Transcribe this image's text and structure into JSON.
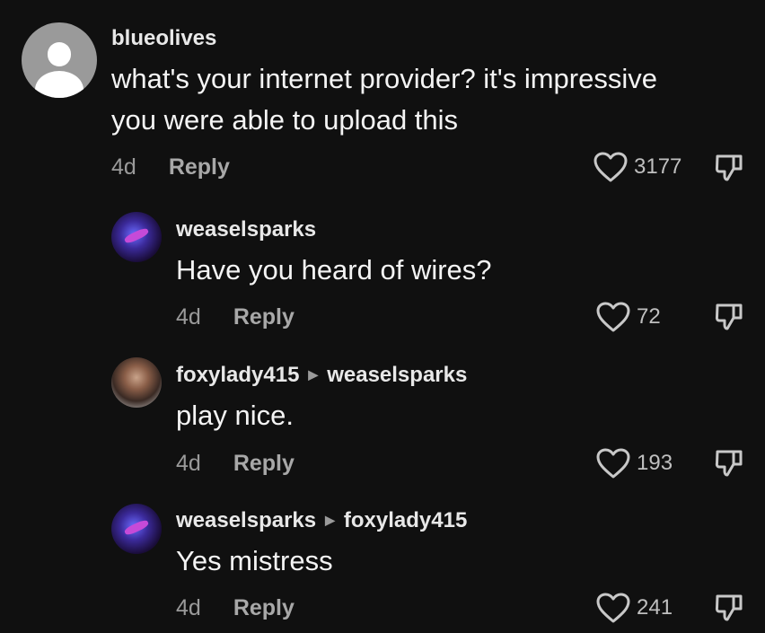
{
  "comments": [
    {
      "username": "blueolives",
      "reply_to": "",
      "text_lines": [
        "what's your internet provider? it's impressive",
        "you were able to upload this"
      ],
      "age": "4d",
      "reply_label": "Reply",
      "likes": "3177",
      "avatar": "default-avatar"
    },
    {
      "username": "weaselsparks",
      "reply_to": "",
      "text_lines": [
        "Have you heard of wires?"
      ],
      "age": "4d",
      "reply_label": "Reply",
      "likes": "72",
      "avatar": "weaselsparks-avatar"
    },
    {
      "username": "foxylady415",
      "reply_to": "weaselsparks",
      "text_lines": [
        "play nice."
      ],
      "age": "4d",
      "reply_label": "Reply",
      "likes": "193",
      "avatar": "foxylady415-avatar"
    },
    {
      "username": "weaselsparks",
      "reply_to": "foxylady415",
      "text_lines": [
        "Yes mistress"
      ],
      "age": "4d",
      "reply_label": "Reply",
      "likes": "241",
      "avatar": "weaselsparks-avatar"
    }
  ],
  "icons": {
    "like": "heart-outline-icon",
    "dislike": "thumbs-down-outline-icon",
    "reply_arrow": "triangle-right-icon"
  },
  "colors": {
    "background": "#101010",
    "text": "#f4f4f4",
    "secondary": "#9a9a9a"
  }
}
